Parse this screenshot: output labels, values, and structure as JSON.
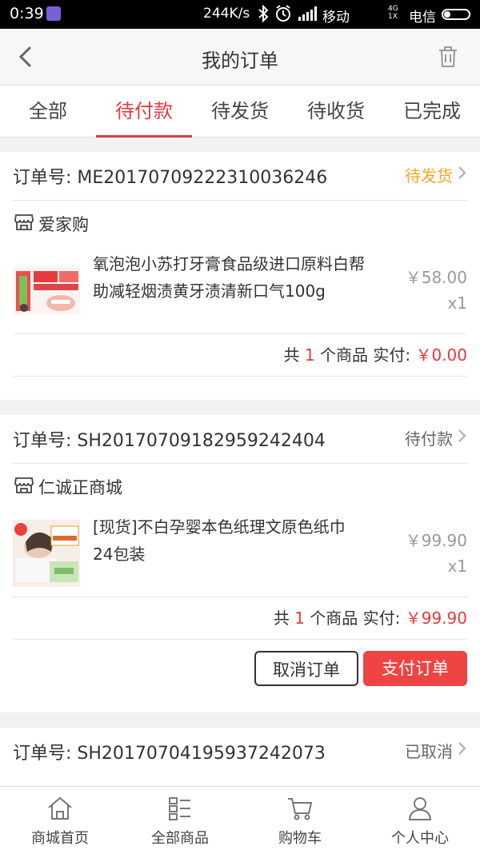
{
  "status_bar": {
    "time": "0:39",
    "network_speed": "244K/s",
    "carrier1": "移动",
    "carrier2": "电信",
    "lte": "4G",
    "lte2": "1X"
  },
  "header": {
    "title": "我的订单",
    "back_icon": "chevron-left-icon",
    "delete_icon": "trash-icon"
  },
  "tabs": [
    {
      "label": "全部",
      "active": false
    },
    {
      "label": "待付款",
      "active": true
    },
    {
      "label": "待发货",
      "active": false
    },
    {
      "label": "待收货",
      "active": false
    },
    {
      "label": "已完成",
      "active": false
    }
  ],
  "orders": [
    {
      "order_no": "订单号: ME20170709222310036246",
      "status": "待发货",
      "status_color": "#f5a623",
      "shop": "爱家购",
      "item": {
        "name": "氧泡泡小苏打牙膏食品级进口原料白帮助减轻烟渍黄牙渍清新口气100g",
        "price": "￥58.00",
        "qty": "x1"
      },
      "summary": {
        "prefix": "共",
        "count": "1",
        "mid": "个商品 实付:",
        "total": "￥0.00"
      }
    },
    {
      "order_no": "订单号: SH20170709182959242404",
      "status": "待付款",
      "status_color": "#666666",
      "shop": "仁诚正商城",
      "item": {
        "name": "[现货]不白孕婴本色纸理文原色纸巾24包装",
        "price": "￥99.90",
        "qty": "x1"
      },
      "summary": {
        "prefix": "共",
        "count": "1",
        "mid": "个商品 实付:",
        "total": "￥99.90"
      },
      "actions": {
        "cancel": "取消订单",
        "pay": "支付订单"
      }
    },
    {
      "order_no": "订单号: SH20170704195937242073",
      "status": "已取消",
      "status_color": "#666666"
    }
  ],
  "bottom_nav": [
    {
      "label": "商城首页",
      "icon": "home-icon"
    },
    {
      "label": "全部商品",
      "icon": "list-icon"
    },
    {
      "label": "购物车",
      "icon": "cart-icon"
    },
    {
      "label": "个人中心",
      "icon": "user-icon"
    }
  ],
  "colors": {
    "accent": "#e5393d",
    "button_red": "#ef4444",
    "pending_orange": "#f5a623"
  }
}
